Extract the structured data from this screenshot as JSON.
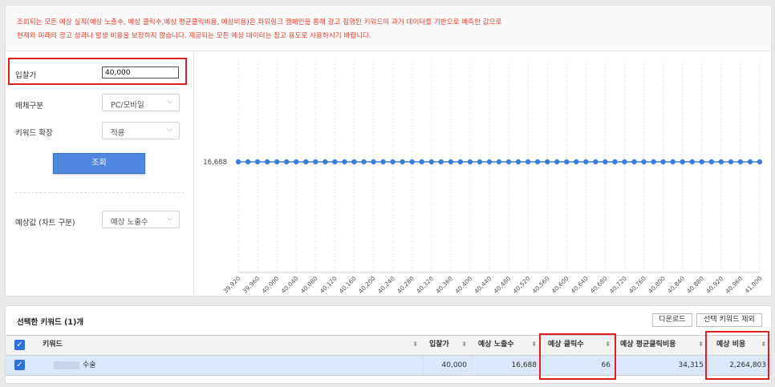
{
  "notice": {
    "line1": "조회되는 모든 예상 실적(예상 노출수, 예상 클릭수,예상 평균클릭비용, 예상비용)은 파워링크 캠페인을 통해 광고 집행된 키워드의 과거 데이터를 기반으로 예측한 값으로",
    "line2": "현재와 미래의 광고 성과나 발생 비용을 보장하지 않습니다. 제공되는 모든 예상 데이터는 참고 용도로 사용하시기 바랍니다."
  },
  "form": {
    "bid_label": "입찰가",
    "bid_value": "40,000",
    "media_label": "매체구분",
    "media_value": "PC/모바일",
    "expand_label": "키워드 확장",
    "expand_value": "적용",
    "search_button": "조회",
    "chart_type_label": "예상값 (차트 구분)",
    "chart_type_value": "예상 노출수"
  },
  "chart_data": {
    "type": "line",
    "x": [
      "39,920",
      "39,960",
      "40,000",
      "40,040",
      "40,080",
      "40,120",
      "40,160",
      "40,200",
      "40,240",
      "40,280",
      "40,320",
      "40,360",
      "40,400",
      "40,440",
      "40,480",
      "40,520",
      "40,560",
      "40,600",
      "40,640",
      "40,680",
      "40,720",
      "40,760",
      "40,800",
      "40,840",
      "40,880",
      "40,920",
      "40,960",
      "41,000"
    ],
    "series": [
      {
        "values": [
          16688,
          16688,
          16688,
          16688,
          16688,
          16688,
          16688,
          16688,
          16688,
          16688,
          16688,
          16688,
          16688,
          16688,
          16688,
          16688,
          16688,
          16688,
          16688,
          16688,
          16688,
          16688,
          16688,
          16688,
          16688,
          16688,
          16688,
          16688,
          16688,
          16688,
          16688,
          16688,
          16688,
          16688,
          16688,
          16688,
          16688,
          16688,
          16688,
          16688,
          16688,
          16688,
          16688,
          16688,
          16688,
          16688,
          16688,
          16688,
          16688,
          16688,
          16688,
          16688,
          16688,
          16688,
          16688
        ]
      }
    ],
    "y_tick": "16,688",
    "point_color": "#3b7ddd",
    "grid": true
  },
  "selected": {
    "title": "선택한 키워드 (1)개",
    "download_button": "다운로드",
    "exclude_button": "선택 키워드 제외",
    "columns": [
      "키워드",
      "입찰가",
      "예상 노출수",
      "예상 클릭수",
      "예상 평균클릭비용",
      "예상 비용"
    ],
    "row": {
      "keyword": "수술",
      "bid": "40,000",
      "impressions": "16,688",
      "clicks": "66",
      "avg_cpc": "34,315",
      "cost": "2,264,803"
    }
  },
  "colors": {
    "notice_text": "#e8402d",
    "highlight_box": "#e02020",
    "primary_button": "#4e86e0",
    "row_selected": "#dbe7fb"
  }
}
